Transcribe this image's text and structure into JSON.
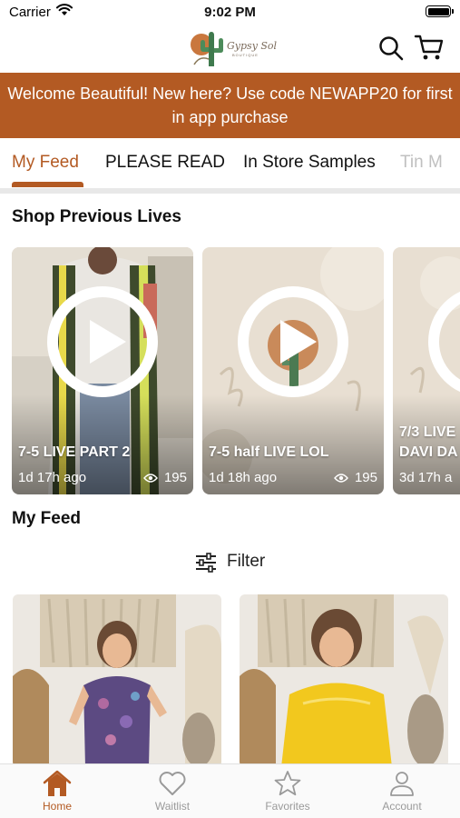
{
  "status_bar": {
    "carrier": "Carrier",
    "time": "9:02 PM"
  },
  "header": {
    "brand": "Gypsy Sol",
    "brand_sub": "BOUTIQUE"
  },
  "promo": {
    "text": "Welcome Beautiful! New here? Use code NEWAPP20 for first in app purchase"
  },
  "tabs": [
    {
      "label": "My Feed"
    },
    {
      "label": "PLEASE READ"
    },
    {
      "label": "In Store Samples"
    },
    {
      "label": "Tin M"
    }
  ],
  "sections": {
    "lives_title": "Shop Previous Lives",
    "feed_title": "My Feed"
  },
  "lives": [
    {
      "title": "7-5 LIVE PART 2",
      "ago": "1d 17h ago",
      "views": "195"
    },
    {
      "title": "7-5 half LIVE LOL",
      "ago": "1d 18h ago",
      "views": "195"
    },
    {
      "title": "7/3 LIVE DAVI DA",
      "ago": "3d 17h a",
      "views": ""
    }
  ],
  "filter": {
    "label": "Filter"
  },
  "nav": [
    {
      "label": "Home",
      "icon": "home-icon"
    },
    {
      "label": "Waitlist",
      "icon": "heart-icon"
    },
    {
      "label": "Favorites",
      "icon": "star-icon"
    },
    {
      "label": "Account",
      "icon": "person-icon"
    }
  ],
  "colors": {
    "brand": "#b35a23",
    "inactive": "#9a9a9a",
    "divider": "#e8e8e8"
  }
}
